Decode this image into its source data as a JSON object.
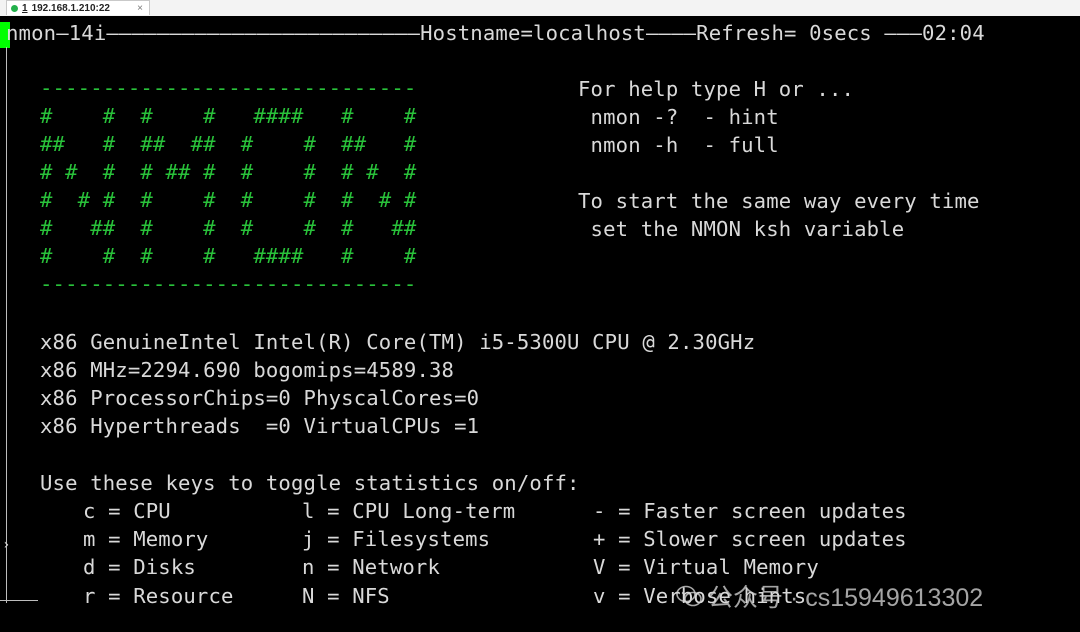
{
  "tab": {
    "number": "1",
    "title": "192.168.1.210:22",
    "close": "×"
  },
  "header": "nmon—14i—————————————————————————Hostname=localhost————Refresh= 0secs ———02:04",
  "logo_lines": [
    "------------------------------",
    "#    #  #    #   ####   #    #",
    "##   #  ##  ##  #    #  ##   #",
    "# #  #  # ## #  #    #  # #  #",
    "#  # #  #    #  #    #  #  # #",
    "#   ##  #    #  #    #  #   ##",
    "#    #  #    #   ####   #    #",
    "------------------------------"
  ],
  "help": {
    "line1": "For help type H or ...",
    "line2": " nmon -?  - hint",
    "line3": " nmon -h  - full",
    "line4": "To start the same way every time",
    "line5": " set the NMON ksh variable"
  },
  "cpu_info": [
    "x86 GenuineIntel Intel(R) Core(TM) i5-5300U CPU @ 2.30GHz",
    "x86 MHz=2294.690 bogomips=4589.38",
    "x86 ProcessorChips=0 PhyscalCores=0",
    "x86 Hyperthreads  =0 VirtualCPUs =1"
  ],
  "keys_heading": "Use these keys to toggle statistics on/off:",
  "keys": [
    [
      "c = CPU",
      "l = CPU Long-term",
      "- = Faster screen updates"
    ],
    [
      "m = Memory",
      "j = Filesystems",
      "+ = Slower screen updates"
    ],
    [
      "d = Disks",
      "n = Network",
      "V = Virtual Memory"
    ],
    [
      "r = Resource",
      "N = NFS",
      "v = Verbose hints"
    ]
  ],
  "marker": "›",
  "watermark": "公众号 · cs15949613302",
  "colors": {
    "logo": "#29c23a",
    "text": "#d9d9d9",
    "cursor": "#00ff00",
    "background": "#000000"
  },
  "icons": {
    "tab_status": "green-dot-icon",
    "watermark": "wechat-icon"
  }
}
